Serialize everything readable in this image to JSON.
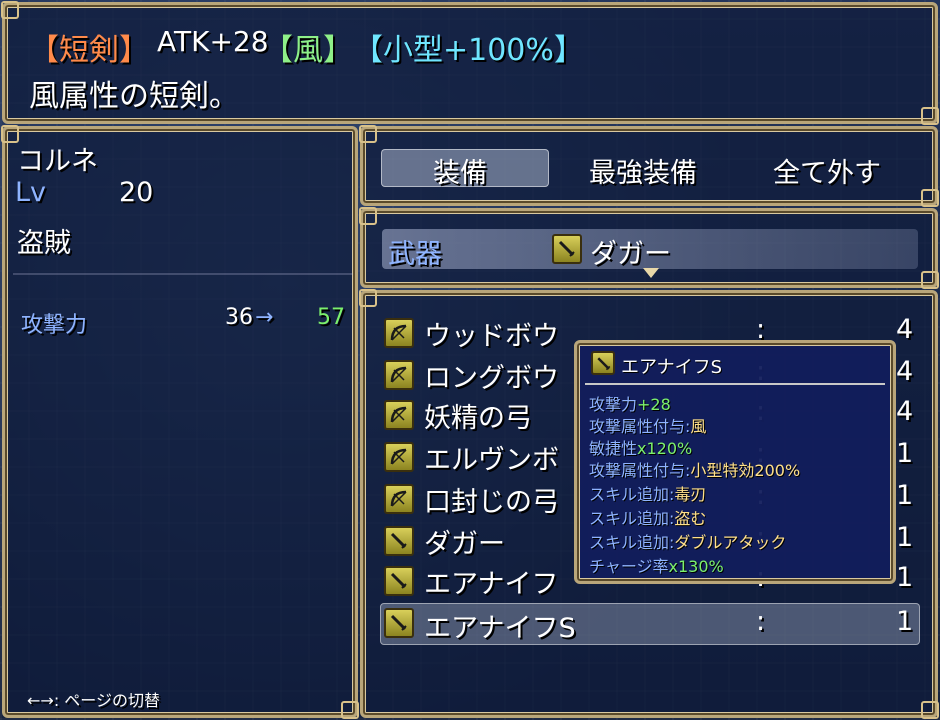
{
  "help": {
    "type_tag": "【短剣】",
    "atk": "ATK+28",
    "element_tag": "【風】",
    "size_tag": "【小型+100%】",
    "description": "風属性の短剣。"
  },
  "actor": {
    "name": "コルネ",
    "lv_label": "Lv",
    "lv_value": "20",
    "class": "盗賊",
    "param_label": "攻撃力",
    "param_before": "36",
    "param_arrow": "→",
    "param_after": "57"
  },
  "commands": [
    "装備",
    "最強装備",
    "全て外す"
  ],
  "slot": {
    "label": "武器",
    "item": "ダガー"
  },
  "items": [
    {
      "name": "ウッドボウ",
      "count": "4",
      "icon": "bow-icon"
    },
    {
      "name": "ロングボウ",
      "count": "4",
      "icon": "bow-icon"
    },
    {
      "name": "妖精の弓",
      "count": "4",
      "icon": "bow-icon"
    },
    {
      "name": "エルヴンボ",
      "count": "1",
      "icon": "bow-icon"
    },
    {
      "name": "口封じの弓",
      "count": "1",
      "icon": "bow-icon"
    },
    {
      "name": "ダガー",
      "count": "1",
      "icon": "dagger-icon"
    },
    {
      "name": "エアナイフ",
      "count": "1",
      "icon": "dagger-icon"
    },
    {
      "name": "エアナイフS",
      "count": "1",
      "icon": "dagger-icon"
    }
  ],
  "colon": ":",
  "tooltip": {
    "title": "エアナイフS",
    "lines": [
      {
        "k": "攻撃力",
        "v": "+28"
      },
      {
        "k": "攻撃属性付与:",
        "v": "風"
      },
      {
        "k": "敏捷性",
        "v": "x120%"
      },
      {
        "k": "攻撃属性付与:",
        "v": "小型特効200%"
      },
      {
        "k": "スキル追加:",
        "v": "毒刃"
      },
      {
        "k": "スキル追加:",
        "v": "盗む"
      },
      {
        "k": "スキル追加:",
        "v": "ダブルアタック"
      },
      {
        "k": "チャージ率",
        "v": "x130%"
      }
    ]
  },
  "footer_hint": "←→: ページの切替",
  "colors": {
    "frame": "#b9a67a",
    "window_bg": "#0e1a3a",
    "stat_up": "#7cf06c",
    "label_blue": "#8fb4ff"
  }
}
